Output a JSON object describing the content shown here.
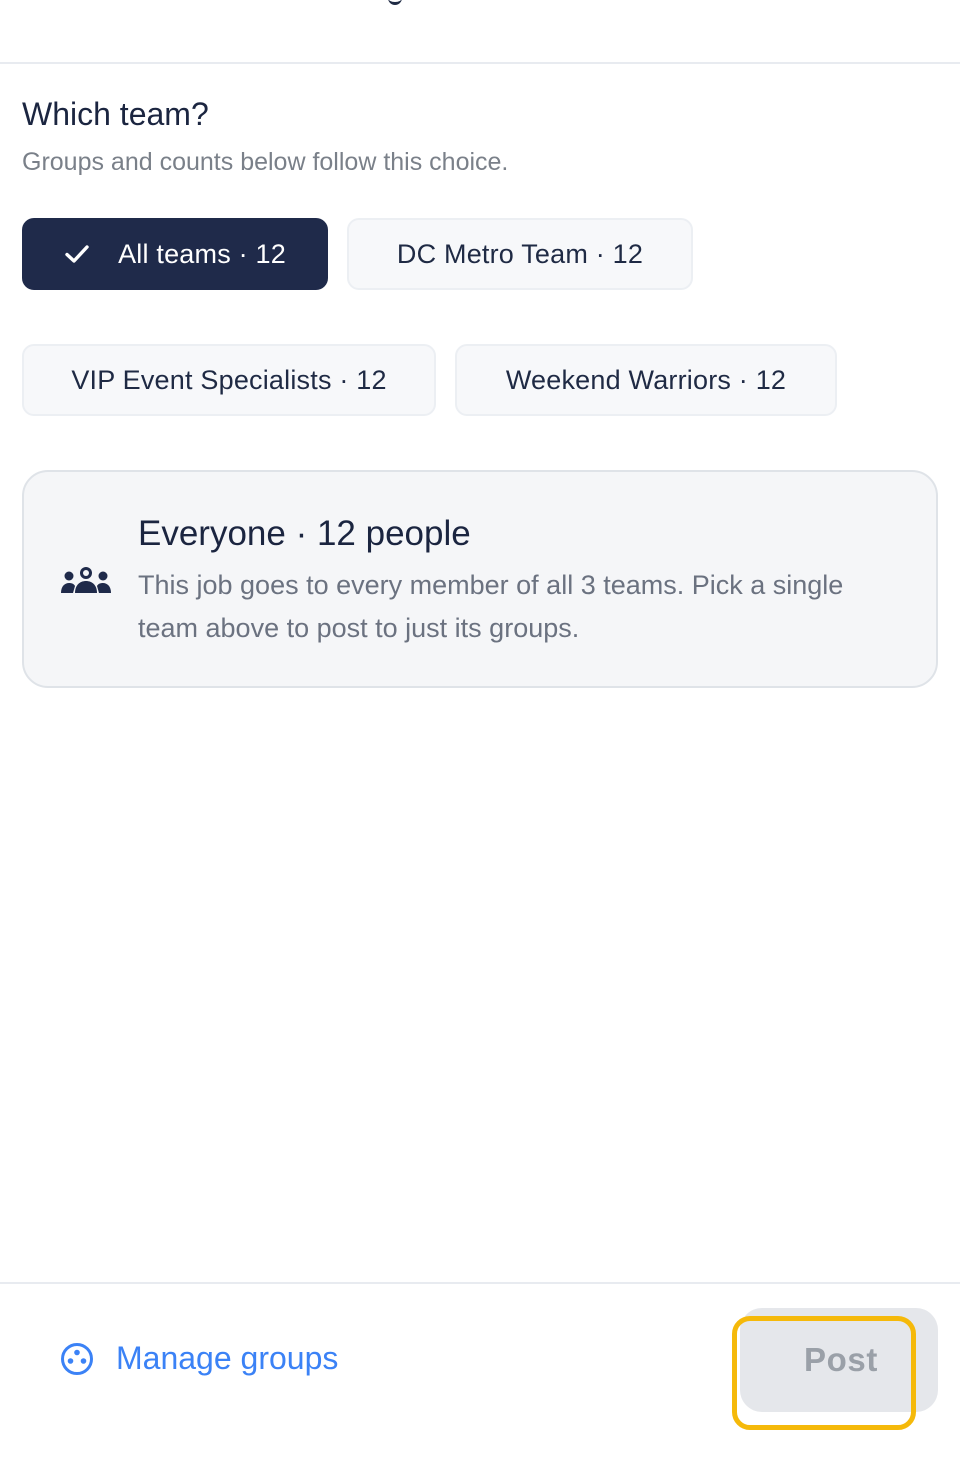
{
  "team_picker": {
    "title": "Which team?",
    "subtitle": "Groups and counts below follow this choice.",
    "options": [
      {
        "label": "All teams · 12",
        "selected": true
      },
      {
        "label": "DC Metro Team · 12",
        "selected": false
      },
      {
        "label": "VIP Event Specialists · 12",
        "selected": false
      },
      {
        "label": "Weekend Warriors · 12",
        "selected": false
      }
    ]
  },
  "info_card": {
    "icon": "people-group-icon",
    "title": "Everyone · 12 people",
    "body": "This job goes to every member of all 3 teams. Pick a single team above to post to just its groups."
  },
  "footer": {
    "manage_label": "Manage groups",
    "manage_icon": "groups-circle-icon",
    "post_label": "Post"
  },
  "colors": {
    "selected_chip": "#1f2a4a",
    "link": "#3b82f6",
    "highlight": "#f5b90a",
    "disabled_button": "#e5e7eb"
  }
}
